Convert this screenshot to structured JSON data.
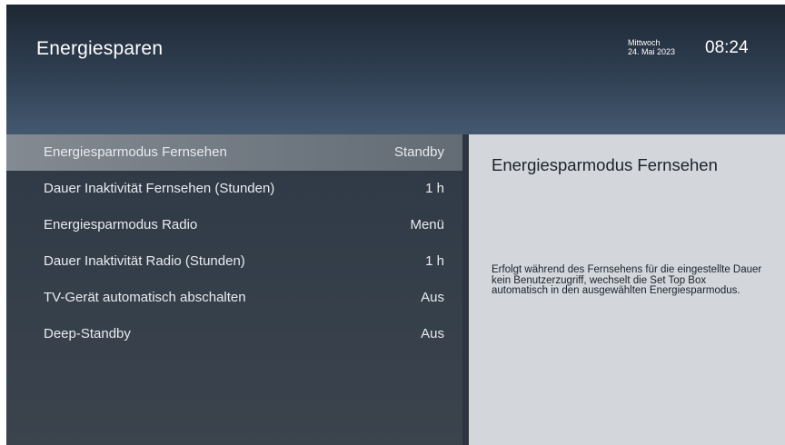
{
  "header": {
    "title": "Energiesparen",
    "weekday": "Mittwoch",
    "date": "24. Mai 2023",
    "time": "08:24"
  },
  "menu": {
    "items": [
      {
        "label": "Energiesparmodus Fernsehen",
        "value": "Standby",
        "selected": true
      },
      {
        "label": "Dauer Inaktivität Fernsehen (Stunden)",
        "value": "1 h",
        "selected": false
      },
      {
        "label": "Energiesparmodus Radio",
        "value": "Menü",
        "selected": false
      },
      {
        "label": "Dauer Inaktivität Radio (Stunden)",
        "value": "1 h",
        "selected": false
      },
      {
        "label": "TV-Gerät automatisch abschalten",
        "value": "Aus",
        "selected": false
      },
      {
        "label": "Deep-Standby",
        "value": "Aus",
        "selected": false
      }
    ]
  },
  "detail": {
    "title": "Energiesparmodus Fernsehen",
    "description": "Erfolgt während des Fernsehens für die eingestellte Dauer kein Benutzerzugriff, wechselt die Set Top Box automatisch in den ausgewählten Energiesparmodus."
  },
  "colors": {
    "selection": "#7a8189",
    "detail_panel": "#d3d7db",
    "header_gradient_top": "#1e2833",
    "header_gradient_bottom": "#43586f"
  }
}
